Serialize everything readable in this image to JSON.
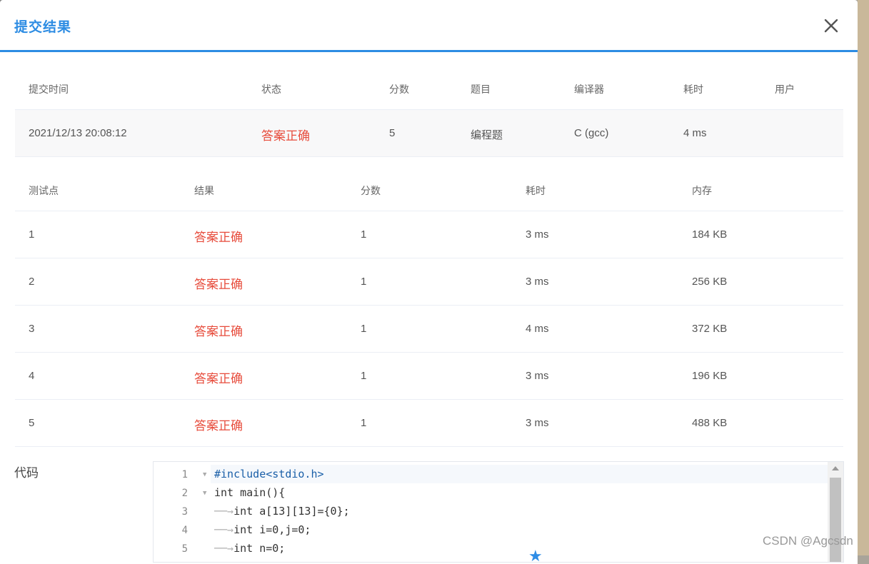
{
  "dialog": {
    "title": "提交结果",
    "close_icon": "close-icon"
  },
  "summary": {
    "headers": [
      "提交时间",
      "状态",
      "分数",
      "题目",
      "编译器",
      "耗时",
      "用户"
    ],
    "row": {
      "time": "2021/12/13 20:08:12",
      "status": "答案正确",
      "score": "5",
      "problem": "编程题",
      "compiler": "C (gcc)",
      "elapsed": "4 ms",
      "user": ""
    }
  },
  "tests": {
    "headers": [
      "测试点",
      "结果",
      "分数",
      "耗时",
      "内存"
    ],
    "rows": [
      {
        "id": "1",
        "result": "答案正确",
        "score": "1",
        "time": "3 ms",
        "memory": "184 KB"
      },
      {
        "id": "2",
        "result": "答案正确",
        "score": "1",
        "time": "3 ms",
        "memory": "256 KB"
      },
      {
        "id": "3",
        "result": "答案正确",
        "score": "1",
        "time": "4 ms",
        "memory": "372 KB"
      },
      {
        "id": "4",
        "result": "答案正确",
        "score": "1",
        "time": "3 ms",
        "memory": "196 KB"
      },
      {
        "id": "5",
        "result": "答案正确",
        "score": "1",
        "time": "3 ms",
        "memory": "488 KB"
      }
    ]
  },
  "code": {
    "label": "代码",
    "line_numbers": [
      "1",
      "2",
      "3",
      "4",
      "5"
    ],
    "lines": [
      "#include<stdio.h>",
      "int main(){",
      "int a[13][13]={0};",
      "int i=0,j=0;",
      "int n=0;"
    ]
  },
  "watermark": "CSDN @Agcsdn",
  "colors": {
    "accent": "#2d8ce3",
    "status_correct": "#e74c3c"
  }
}
